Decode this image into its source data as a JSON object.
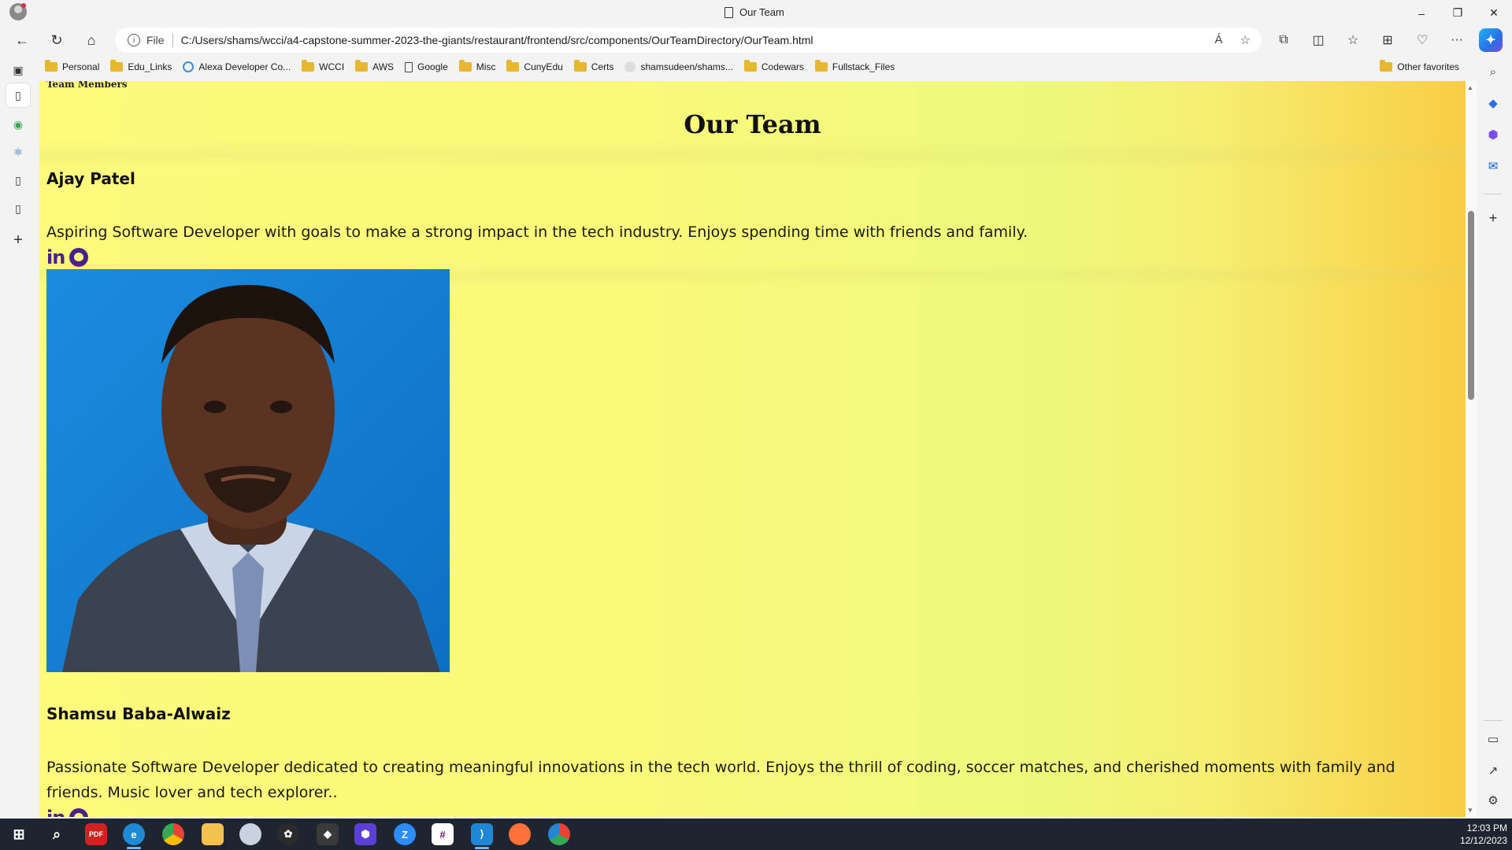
{
  "window": {
    "tab_title": "Our Team",
    "controls": {
      "minimize": "–",
      "restore": "❐",
      "close": "✕"
    }
  },
  "address_bar": {
    "scheme": "File",
    "url": "C:/Users/shams/wcci/a4-capstone-summer-2023-the-giants/restaurant/frontend/src/components/OurTeamDirectory/OurTeam.html",
    "read_aloud": "Á",
    "favorite": "☆"
  },
  "favorites": [
    {
      "label": "Personal",
      "icon": "folder"
    },
    {
      "label": "Edu_Links",
      "icon": "folder"
    },
    {
      "label": "Alexa Developer Co...",
      "icon": "alexa-ring"
    },
    {
      "label": "WCCI",
      "icon": "folder"
    },
    {
      "label": "AWS",
      "icon": "folder"
    },
    {
      "label": "Google",
      "icon": "page"
    },
    {
      "label": "Misc",
      "icon": "folder"
    },
    {
      "label": "CunyEdu",
      "icon": "folder"
    },
    {
      "label": "Certs",
      "icon": "folder"
    },
    {
      "label": "shamsudeen/shams...",
      "icon": "github"
    },
    {
      "label": "Codewars",
      "icon": "folder"
    },
    {
      "label": "Fullstack_Files",
      "icon": "folder"
    }
  ],
  "other_favorites": "Other favorites",
  "page": {
    "nav_label": "Team Members",
    "title": "Our Team",
    "members": [
      {
        "name": "Ajay Patel",
        "bio": "Aspiring Software Developer with goals to make a strong impact in the tech industry. Enjoys spending time with friends and family.",
        "linkedin": "in"
      },
      {
        "name": "Shamsu Baba-Alwaiz",
        "bio": "Passionate Software Developer dedicated to creating meaningful innovations in the tech world. Enjoys the thrill of coding, soccer matches, and cherished moments with family and friends. Music lover and tech explorer..",
        "linkedin": "in"
      }
    ]
  },
  "taskbar": {
    "pdf_label": "PDF",
    "zoom_label": "Z",
    "time": "12:03 PM",
    "date": "12/12/2023"
  },
  "colors": {
    "page_gradient_start": "#fdfa7c",
    "page_gradient_end": "#f9cd44",
    "social_icon": "#4b1e8a"
  }
}
